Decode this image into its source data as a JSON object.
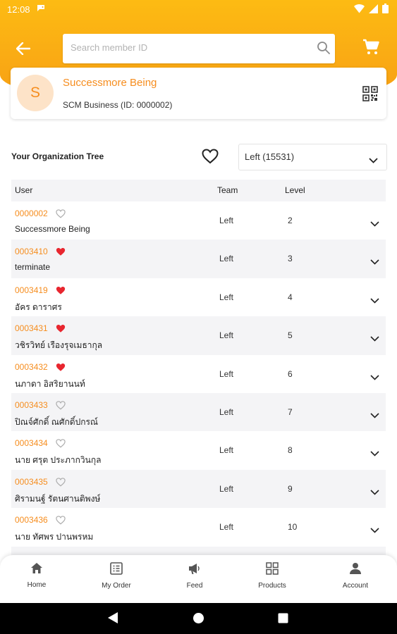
{
  "status_bar": {
    "time": "12:08"
  },
  "search": {
    "placeholder": "Search member ID",
    "value": ""
  },
  "profile": {
    "initial": "S",
    "name": "Successmore Being",
    "subtitle": "SCM Business (ID: 0000002)"
  },
  "org": {
    "title": "Your Organization Tree",
    "filter_value": "Left (15531)"
  },
  "table": {
    "headers": {
      "user": "User",
      "team": "Team",
      "level": "Level"
    },
    "rows": [
      {
        "id": "0000002",
        "name": "Successmore Being",
        "team": "Left",
        "level": "2",
        "favorite": false
      },
      {
        "id": "0003410",
        "name": "terminate",
        "team": "Left",
        "level": "3",
        "favorite": true
      },
      {
        "id": "0003419",
        "name": "อัคร ดาราศร",
        "team": "Left",
        "level": "4",
        "favorite": true
      },
      {
        "id": "0003431",
        "name": "วชิรวิทย์ เรืองรุจเมธากุล",
        "team": "Left",
        "level": "5",
        "favorite": true
      },
      {
        "id": "0003432",
        "name": "นภาดา  อิสริยานนท์",
        "team": "Left",
        "level": "6",
        "favorite": true
      },
      {
        "id": "0003433",
        "name": "ปิณจ์ศักดิ์ ณศักดิ์ปกรณ์",
        "team": "Left",
        "level": "7",
        "favorite": false
      },
      {
        "id": "0003434",
        "name": " นาย ศรุต ประภากวินกุล",
        "team": "Left",
        "level": "8",
        "favorite": false
      },
      {
        "id": "0003435",
        "name": "ศิรามนฐ์ รัตนศานติพงษ์",
        "team": "Left",
        "level": "9",
        "favorite": false
      },
      {
        "id": "0003436",
        "name": " นาย ทัศพร ปานพรหม",
        "team": "Left",
        "level": "10",
        "favorite": false
      }
    ]
  },
  "bottom_nav": [
    {
      "label": "Home",
      "icon": "home-icon"
    },
    {
      "label": "My Order",
      "icon": "order-icon"
    },
    {
      "label": "Feed",
      "icon": "megaphone-icon"
    },
    {
      "label": "Products",
      "icon": "grid-icon"
    },
    {
      "label": "Account",
      "icon": "person-icon"
    }
  ],
  "colors": {
    "accent": "#f68d1e",
    "header": "#fdb515",
    "heart_filled": "#e8262f",
    "row_alt": "#f4f4f6"
  }
}
